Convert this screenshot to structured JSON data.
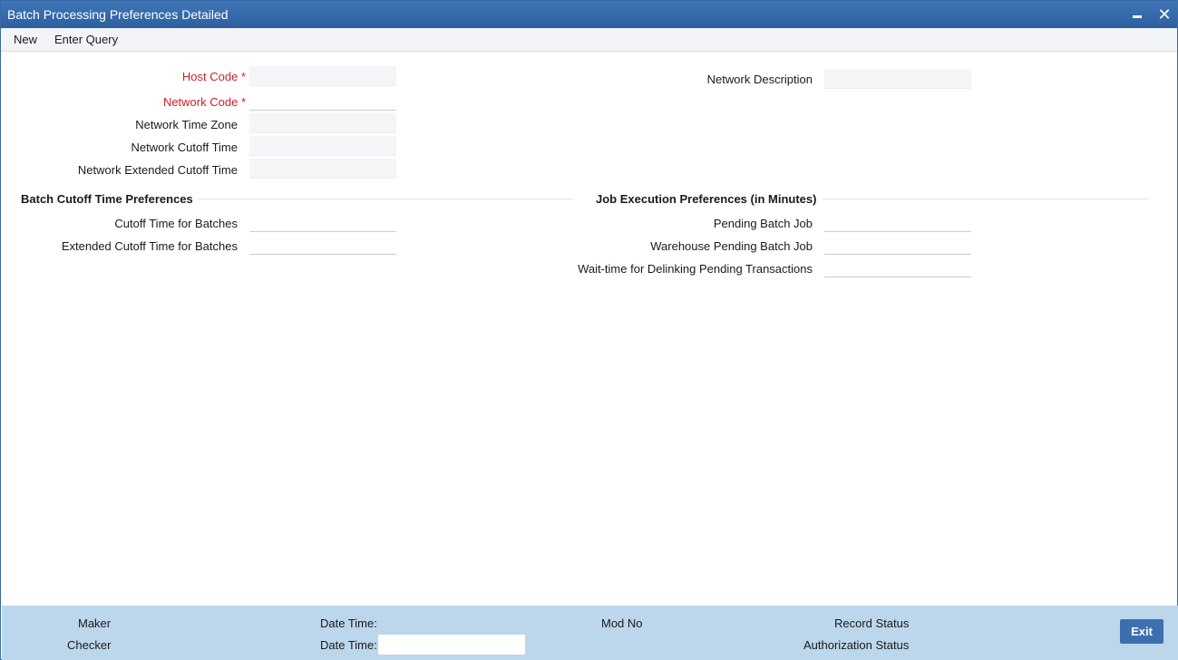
{
  "window": {
    "title": "Batch Processing Preferences Detailed",
    "minimize_glyph": "",
    "close_glyph": "✕"
  },
  "menu": {
    "new": "New",
    "enter_query": "Enter Query"
  },
  "fields": {
    "host_code": {
      "label": "Host Code",
      "required_mark": "*",
      "value": ""
    },
    "network_code": {
      "label": "Network Code",
      "required_mark": "*",
      "value": ""
    },
    "network_time_zone": {
      "label": "Network Time Zone",
      "value": ""
    },
    "network_cutoff_time": {
      "label": "Network Cutoff Time",
      "value": ""
    },
    "network_extended_cutoff_time": {
      "label": "Network Extended Cutoff Time",
      "value": ""
    },
    "network_description": {
      "label": "Network Description",
      "value": ""
    }
  },
  "batch_cutoff": {
    "title": "Batch Cutoff Time Preferences",
    "cutoff_time_for_batches": {
      "label": "Cutoff Time for Batches",
      "value": ""
    },
    "extended_cutoff_time_for_batches": {
      "label": "Extended Cutoff Time for Batches",
      "value": ""
    }
  },
  "job_execution": {
    "title": "Job Execution Preferences (in Minutes)",
    "pending_batch_job": {
      "label": "Pending Batch Job",
      "value": ""
    },
    "warehouse_pending_batch_job": {
      "label": "Warehouse Pending Batch Job",
      "value": ""
    },
    "wait_time_delinking": {
      "label": "Wait-time for Delinking Pending Transactions",
      "value": ""
    }
  },
  "footer": {
    "maker": "Maker",
    "checker": "Checker",
    "date_time_1": "Date Time:",
    "date_time_2": "Date Time:",
    "mod_no": "Mod No",
    "record_status": "Record Status",
    "authorization_status": "Authorization Status",
    "exit": "Exit"
  },
  "colors": {
    "title_bar": "#2d5f9e",
    "required_label": "#d0202a",
    "footer_bg": "#bcd6ec",
    "exit_button": "#3d6fae"
  }
}
